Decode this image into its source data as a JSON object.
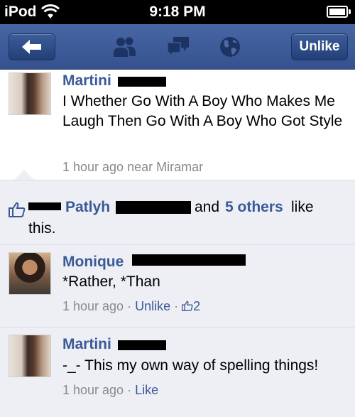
{
  "status_bar": {
    "carrier": "iPod",
    "time": "9:18 PM"
  },
  "navbar": {
    "unlike_label": "Unlike",
    "icons": [
      "back-arrow-icon",
      "friends-icon",
      "messages-icon",
      "globe-icon"
    ]
  },
  "post": {
    "author": "Martini",
    "text": "I Whether Go With A Boy Who Makes Me Laugh Then Go With A Boy Who Got Style",
    "time": "1 hour ago",
    "location": "near Miramar"
  },
  "likes": {
    "first_name": "Patlyh",
    "and_text": "and",
    "others": "5 others",
    "like_text": "like",
    "tail": "this."
  },
  "comments": [
    {
      "author": "Monique",
      "text": "*Rather, *Than",
      "time": "1 hour ago",
      "action": "Unlike",
      "like_count": "2"
    },
    {
      "author": "Martini",
      "text": "-_- This my own way of spelling things!",
      "time": "1 hour ago",
      "action": "Like"
    }
  ],
  "separator": "·",
  "colors": {
    "fb_blue": "#3b5998",
    "nav_top": "#4866a3",
    "nav_bottom": "#35528f",
    "comment_bg": "#edeff4"
  }
}
